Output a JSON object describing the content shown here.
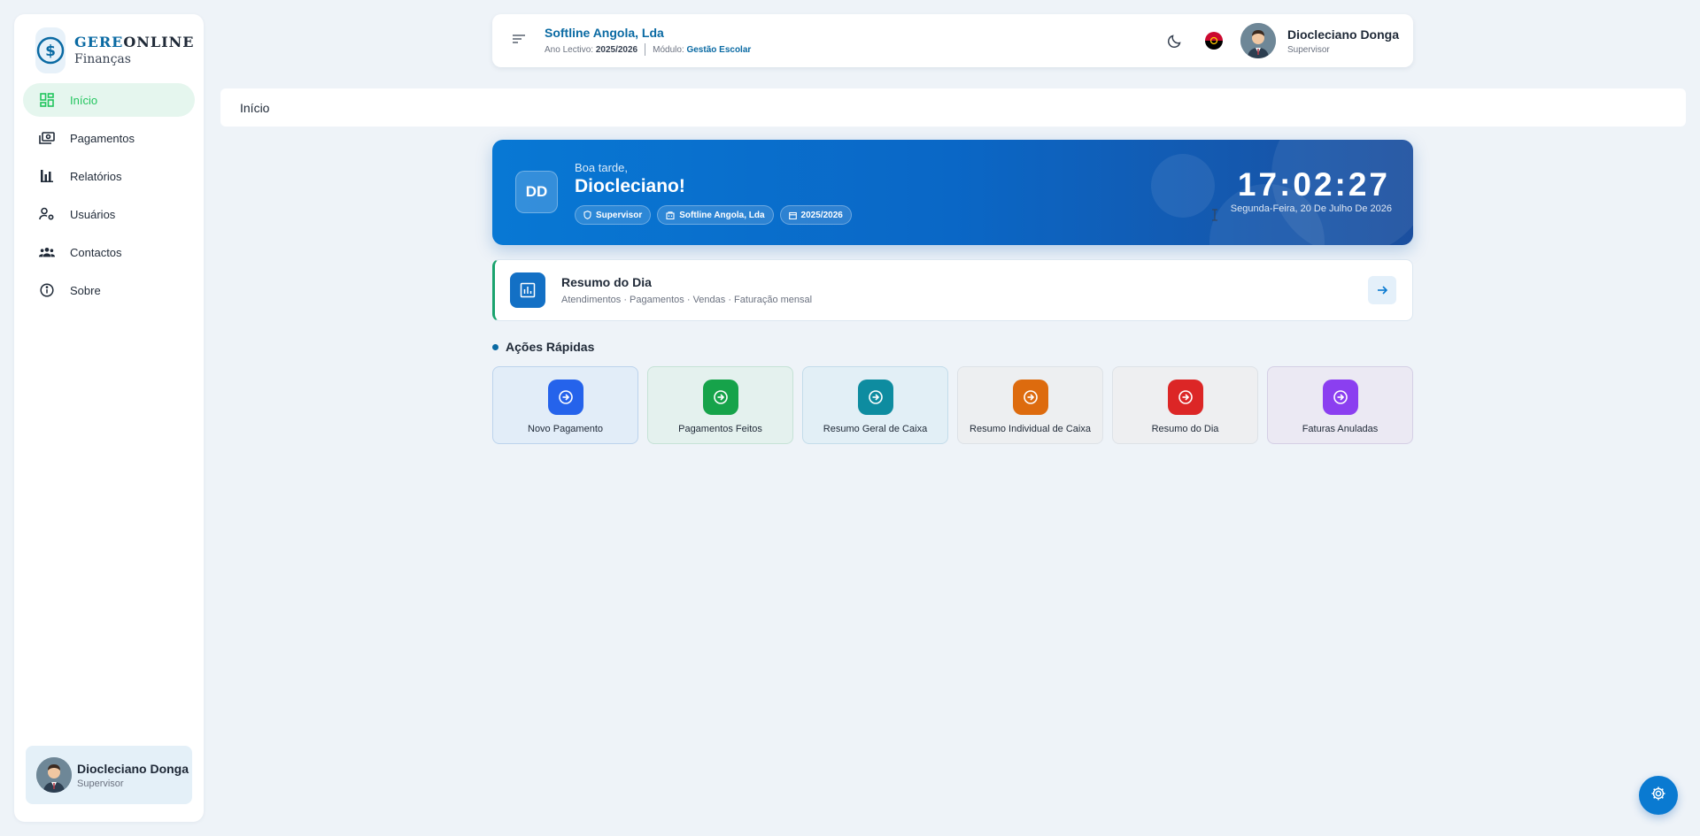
{
  "sidebar": {
    "brand": {
      "part1": "GERE",
      "part2": "ONLINE",
      "subtitle": "Finanças"
    },
    "items": [
      {
        "label": "Início",
        "icon": "dashboard-icon",
        "active": true
      },
      {
        "label": "Pagamentos",
        "icon": "payments-icon"
      },
      {
        "label": "Relatórios",
        "icon": "bar-chart-icon"
      },
      {
        "label": "Usuários",
        "icon": "user-settings-icon"
      },
      {
        "label": "Contactos",
        "icon": "contacts-icon"
      },
      {
        "label": "Sobre",
        "icon": "info-icon"
      }
    ],
    "user": {
      "name": "Diocleciano Donga",
      "role": "Supervisor"
    }
  },
  "topbar": {
    "company": "Softline Angola, Lda",
    "year_label": "Ano Lectivo:",
    "year_value": "2025/2026",
    "module_label": "Módulo:",
    "module_value": "Gestão Escolar",
    "user": {
      "name": "Diocleciano Donga",
      "role": "Supervisor"
    }
  },
  "breadcrumb": {
    "current": "Início"
  },
  "hero": {
    "initials": "DD",
    "greeting": "Boa tarde,",
    "name": "Diocleciano!",
    "chips": [
      "Supervisor",
      "Softline Angola, Lda",
      "2025/2026"
    ],
    "time": "17:02:27",
    "date": "Segunda-Feira, 20 De Julho De 2026"
  },
  "resumo": {
    "title": "Resumo do Dia",
    "subtitle": "Atendimentos · Pagamentos · Vendas · Faturação mensal"
  },
  "quick_actions": {
    "title": "Ações Rápidas",
    "items": [
      {
        "label": "Novo Pagamento",
        "color": "#2563eb",
        "bg": "#e2edf8",
        "border": "#bcd3ec"
      },
      {
        "label": "Pagamentos Feitos",
        "color": "#16a34a",
        "bg": "#e4f1ee",
        "border": "#c5e2d6"
      },
      {
        "label": "Resumo Geral de Caixa",
        "color": "#0e8ca0",
        "bg": "#e2eff6",
        "border": "#c3dcea"
      },
      {
        "label": "Resumo Individual de Caixa",
        "color": "#dd6b0e",
        "bg": "#edeff1",
        "border": "#dde2e7"
      },
      {
        "label": "Resumo do Dia",
        "color": "#dc2626",
        "bg": "#eeeff1",
        "border": "#dde2e7"
      },
      {
        "label": "Faturas Anuladas",
        "color": "#8b3ff0",
        "bg": "#ebe9f3",
        "border": "#d4cfe5"
      }
    ]
  },
  "colors": {
    "accent": "#0a6aa3",
    "active": "#22c55e",
    "hero_start": "#0878d4",
    "hero_end": "#1b4f9f"
  }
}
